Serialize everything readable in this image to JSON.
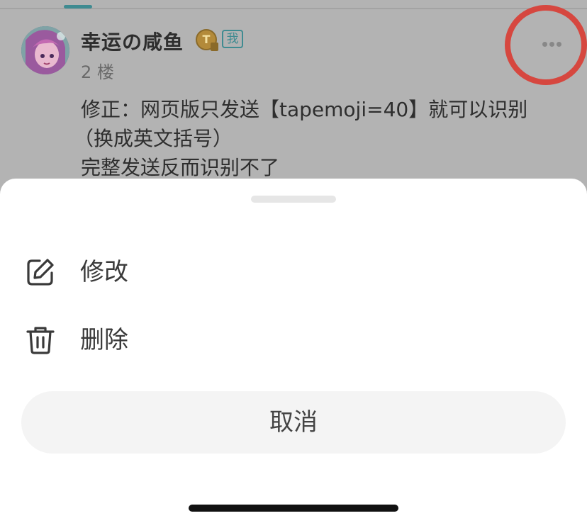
{
  "post": {
    "author": "幸运の咸鱼",
    "coin_badge_letter": "T",
    "self_badge": "我",
    "floor": "2 楼",
    "content_lines": [
      "修正：网页版只发送【tapemoji=40】就可以识别",
      "（换成英文括号）",
      "完整发送反而识别不了"
    ]
  },
  "action_sheet": {
    "items": [
      {
        "label": "修改",
        "icon": "edit-icon"
      },
      {
        "label": "删除",
        "icon": "trash-icon"
      }
    ],
    "cancel_label": "取消"
  },
  "colors": {
    "overlay": "#b3b3b3",
    "accent": "#3f8b91",
    "highlight_annotation": "#d6473f",
    "sheet_background": "#ffffff",
    "cancel_background": "#f4f4f4"
  }
}
